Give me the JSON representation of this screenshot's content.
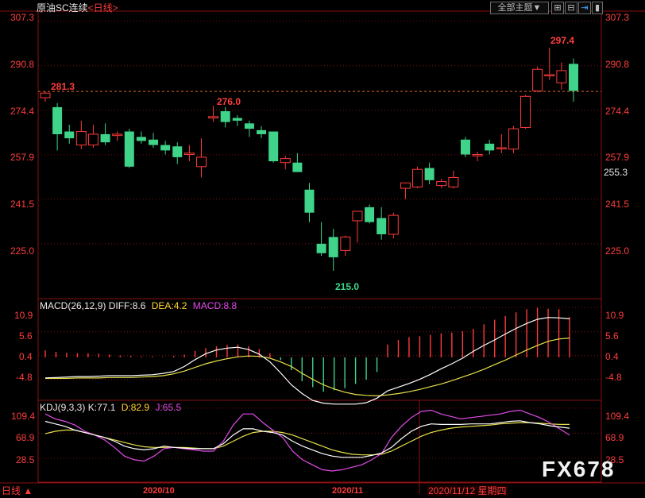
{
  "header": {
    "title": "原油SC连续",
    "period": "<日线>",
    "theme_button": "全部主题▼"
  },
  "colors": {
    "up": "#ff3b3b",
    "down": "#3fd48a",
    "diff": "#ffffff",
    "dea": "#e8e04a",
    "macd_text": "#e24bea",
    "k": "#ffffff",
    "d": "#e8e04a",
    "j": "#e24bea",
    "grid": "#7a1010",
    "dashed": "#e06a2a"
  },
  "price_panel": {
    "y_ticks": [
      "307.3",
      "290.8",
      "274.4",
      "257.9",
      "241.5",
      "225.0"
    ],
    "last_price": "255.3",
    "ref_line": 281.3,
    "annotations": {
      "high_left": "281.3",
      "mid_high": "276.0",
      "low": "215.0",
      "high_right": "297.4"
    }
  },
  "macd_panel": {
    "label": "MACD(26,12,9)",
    "diff_label": "DIFF:8.6",
    "dea_label": "DEA:4.2",
    "macd_label": "MACD:8.8",
    "y_ticks": [
      "10.9",
      "5.6",
      "0.4",
      "-4.8"
    ]
  },
  "kdj_panel": {
    "label": "KDJ(9,3,3)",
    "k_label": "K:77.1",
    "d_label": "D:82.9",
    "j_label": "J:65.5",
    "y_ticks": [
      "109.4",
      "68.9",
      "28.5"
    ]
  },
  "x_axis": {
    "labels": [
      "2020/10",
      "2020/11"
    ],
    "cursor_date": "2020/11/12 星期四",
    "scroll_label": "日线 ▲"
  },
  "watermark": "FX678",
  "chart_data": {
    "type": "candlestick",
    "title": "原油SC连续",
    "ylim": [
      205,
      311
    ],
    "candles": [
      {
        "o": 279.0,
        "h": 281.3,
        "l": 277.5,
        "c": 280.7
      },
      {
        "o": 275.5,
        "h": 277.0,
        "l": 259.5,
        "c": 265.5
      },
      {
        "o": 266.5,
        "h": 269.0,
        "l": 262.0,
        "c": 264.0
      },
      {
        "o": 261.5,
        "h": 270.5,
        "l": 260.0,
        "c": 266.5
      },
      {
        "o": 261.5,
        "h": 269.0,
        "l": 260.5,
        "c": 265.5
      },
      {
        "o": 265.5,
        "h": 269.5,
        "l": 261.5,
        "c": 262.5
      },
      {
        "o": 265.0,
        "h": 266.5,
        "l": 263.0,
        "c": 265.5
      },
      {
        "o": 266.5,
        "h": 267.5,
        "l": 253.0,
        "c": 253.5
      },
      {
        "o": 264.5,
        "h": 266.5,
        "l": 262.0,
        "c": 263.0
      },
      {
        "o": 263.5,
        "h": 266.0,
        "l": 260.5,
        "c": 261.5
      },
      {
        "o": 261.5,
        "h": 263.0,
        "l": 258.0,
        "c": 259.5
      },
      {
        "o": 261.0,
        "h": 262.5,
        "l": 254.5,
        "c": 257.0
      },
      {
        "o": 258.0,
        "h": 261.5,
        "l": 255.5,
        "c": 258.5
      },
      {
        "o": 253.5,
        "h": 264.0,
        "l": 249.5,
        "c": 257.0
      },
      {
        "o": 271.5,
        "h": 276.0,
        "l": 270.0,
        "c": 272.0
      },
      {
        "o": 274.0,
        "h": 275.5,
        "l": 268.0,
        "c": 270.0
      },
      {
        "o": 271.5,
        "h": 272.5,
        "l": 268.5,
        "c": 270.5
      },
      {
        "o": 269.5,
        "h": 270.5,
        "l": 264.5,
        "c": 267.5
      },
      {
        "o": 267.0,
        "h": 268.5,
        "l": 264.0,
        "c": 265.5
      },
      {
        "o": 266.5,
        "h": 266.5,
        "l": 255.0,
        "c": 255.5
      },
      {
        "o": 255.0,
        "h": 257.5,
        "l": 252.5,
        "c": 256.5
      },
      {
        "o": 255.0,
        "h": 258.5,
        "l": 251.5,
        "c": 251.5
      },
      {
        "o": 245.0,
        "h": 247.5,
        "l": 233.0,
        "c": 236.5
      },
      {
        "o": 225.0,
        "h": 233.0,
        "l": 220.5,
        "c": 221.5
      },
      {
        "o": 227.5,
        "h": 230.5,
        "l": 215.0,
        "c": 220.0
      },
      {
        "o": 222.5,
        "h": 228.0,
        "l": 220.5,
        "c": 227.5
      },
      {
        "o": 233.5,
        "h": 237.0,
        "l": 225.5,
        "c": 237.0
      },
      {
        "o": 238.5,
        "h": 239.5,
        "l": 232.5,
        "c": 233.0
      },
      {
        "o": 234.5,
        "h": 238.5,
        "l": 226.5,
        "c": 228.5
      },
      {
        "o": 228.5,
        "h": 236.5,
        "l": 227.0,
        "c": 235.5
      },
      {
        "o": 245.5,
        "h": 247.5,
        "l": 241.5,
        "c": 247.5
      },
      {
        "o": 246.0,
        "h": 253.5,
        "l": 245.5,
        "c": 252.5
      },
      {
        "o": 253.0,
        "h": 255.0,
        "l": 247.0,
        "c": 248.5
      },
      {
        "o": 246.5,
        "h": 249.0,
        "l": 245.5,
        "c": 248.0
      },
      {
        "o": 246.0,
        "h": 252.0,
        "l": 245.5,
        "c": 249.5
      },
      {
        "o": 263.5,
        "h": 264.5,
        "l": 257.0,
        "c": 258.0
      },
      {
        "o": 257.5,
        "h": 259.0,
        "l": 255.5,
        "c": 258.0
      },
      {
        "o": 262.0,
        "h": 263.5,
        "l": 258.0,
        "c": 259.5
      },
      {
        "o": 260.5,
        "h": 265.5,
        "l": 258.5,
        "c": 260.5
      },
      {
        "o": 260.0,
        "h": 268.5,
        "l": 258.5,
        "c": 267.5
      },
      {
        "o": 268.0,
        "h": 280.0,
        "l": 267.5,
        "c": 279.5
      },
      {
        "o": 281.5,
        "h": 290.5,
        "l": 281.0,
        "c": 289.5
      },
      {
        "o": 287.5,
        "h": 297.4,
        "l": 285.5,
        "c": 287.5
      },
      {
        "o": 284.5,
        "h": 292.0,
        "l": 282.0,
        "c": 289.0
      },
      {
        "o": 291.5,
        "h": 293.5,
        "l": 277.5,
        "c": 281.5
      }
    ],
    "macd_hist": [
      1.5,
      1.2,
      1.0,
      0.9,
      0.9,
      0.8,
      0.6,
      0.4,
      0.3,
      0.2,
      0.2,
      0.1,
      0.3,
      0.6,
      1.4,
      2.0,
      2.4,
      2.7,
      2.8,
      2.4,
      1.8,
      0.9,
      -0.6,
      -2.8,
      -5.2,
      -6.5,
      -7.5,
      -7.2,
      -6.7,
      -5.8,
      -4.9,
      -3.2,
      2.8,
      3.8,
      4.4,
      4.6,
      4.9,
      5.2,
      5.4,
      5.7,
      6.2,
      7.2,
      8.2,
      9.0,
      9.8,
      10.5,
      10.8,
      10.6,
      10.5,
      8.8
    ],
    "macd_diff": [
      -4.5,
      -4.4,
      -4.3,
      -4.2,
      -4.2,
      -4.1,
      -4.0,
      -4.0,
      -4.0,
      -3.9,
      -3.8,
      -3.5,
      -3.1,
      -2.0,
      -0.5,
      0.8,
      1.6,
      2.0,
      2.2,
      1.7,
      0.7,
      -1.0,
      -3.4,
      -6.0,
      -7.9,
      -9.4,
      -10.0,
      -10.2,
      -10.2,
      -10.2,
      -9.9,
      -8.9,
      -7.3,
      -6.5,
      -5.7,
      -4.8,
      -3.7,
      -2.5,
      -1.4,
      -0.2,
      1.3,
      2.6,
      3.8,
      5.1,
      6.3,
      7.4,
      8.3,
      8.7,
      8.6,
      8.4
    ],
    "macd_dea": [
      -4.6,
      -4.6,
      -4.6,
      -4.5,
      -4.5,
      -4.5,
      -4.4,
      -4.4,
      -4.4,
      -4.3,
      -4.2,
      -4.0,
      -3.6,
      -3.0,
      -2.2,
      -1.4,
      -0.8,
      -0.3,
      0.1,
      0.3,
      0.2,
      -0.2,
      -1.0,
      -2.0,
      -3.5,
      -4.8,
      -6.0,
      -6.9,
      -7.6,
      -8.1,
      -8.3,
      -8.4,
      -8.2,
      -7.9,
      -7.5,
      -7.0,
      -6.4,
      -5.8,
      -5.1,
      -4.3,
      -3.5,
      -2.6,
      -1.6,
      -0.6,
      0.5,
      1.6,
      2.6,
      3.5,
      4.0,
      4.2
    ],
    "kdj_k": [
      88,
      84,
      80,
      74,
      70,
      66,
      62,
      56,
      48,
      44,
      42,
      44,
      48,
      46,
      45,
      44,
      44,
      44,
      52,
      66,
      76,
      76,
      72,
      70,
      66,
      56,
      48,
      42,
      36,
      32,
      30,
      30,
      30,
      33,
      37,
      46,
      60,
      72,
      80,
      84,
      83,
      83,
      83,
      84,
      84,
      84,
      86,
      88,
      89,
      86,
      84,
      81,
      79,
      77
    ],
    "kdj_d": [
      68,
      72,
      74,
      74,
      70,
      66,
      62,
      58,
      54,
      50,
      47,
      46,
      46,
      46,
      46,
      45,
      44,
      44,
      48,
      56,
      64,
      70,
      72,
      72,
      70,
      66,
      60,
      54,
      48,
      42,
      38,
      35,
      34,
      34,
      35,
      40,
      48,
      56,
      64,
      70,
      74,
      77,
      79,
      80,
      81,
      82,
      84,
      85,
      86,
      86,
      85,
      84,
      83,
      83
    ],
    "kdj_j": [
      100,
      92,
      88,
      82,
      72,
      66,
      58,
      46,
      32,
      26,
      24,
      32,
      44,
      46,
      44,
      42,
      40,
      40,
      56,
      82,
      100,
      100,
      86,
      74,
      62,
      40,
      26,
      18,
      10,
      8,
      10,
      14,
      18,
      26,
      36,
      62,
      80,
      94,
      104,
      106,
      100,
      96,
      92,
      94,
      96,
      98,
      100,
      104,
      106,
      100,
      94,
      86,
      76,
      66
    ]
  }
}
